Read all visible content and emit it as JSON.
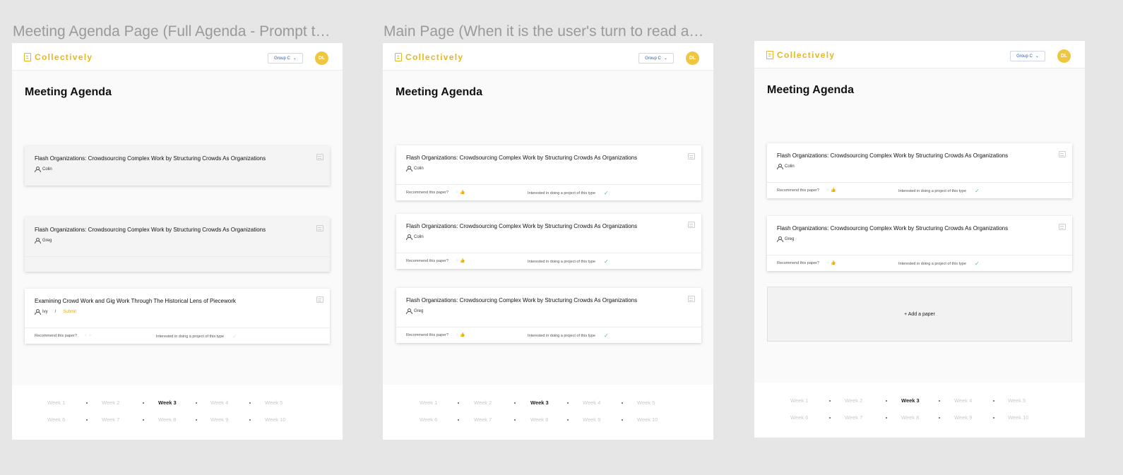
{
  "frames": [
    {
      "label": "Meeting Agenda Page (Full Agenda - Prompt to submit my papers)"
    },
    {
      "label": "Main Page (When it is the user's turn to read and comment)"
    },
    {
      "label": ""
    }
  ],
  "app": {
    "brand": "Collectively",
    "group": "Group C",
    "avatar": "DL",
    "page_title": "Meeting Agenda"
  },
  "labels": {
    "recommend": "Recommend this paper?",
    "interested": "Interested in doing a project of this type",
    "add_paper": "+ Add a paper",
    "submit": "Submit",
    "slash": "/"
  },
  "papers": {
    "flash": "Flash Organizations: Crowdsourcing Complex Work by Structuring Crowds As Organizations",
    "crowd": "Examining Crowd Work and Gig Work Through The Historical Lens of Piecework"
  },
  "people": {
    "colin": "Colin",
    "greg": "Greg",
    "ivy": "Ivy"
  },
  "weeks": {
    "row1": [
      "Week 1",
      "Week 2",
      "Week 3",
      "Week 4",
      "Week 5"
    ],
    "row2": [
      "Week 6",
      "Week 7",
      "Week 8",
      "Week 9",
      "Week 10"
    ],
    "active": "Week 3"
  },
  "colors": {
    "brand": "#e8b524",
    "avatar": "#f0c640",
    "check": "#4bc57a",
    "submit": "#e8a818"
  }
}
